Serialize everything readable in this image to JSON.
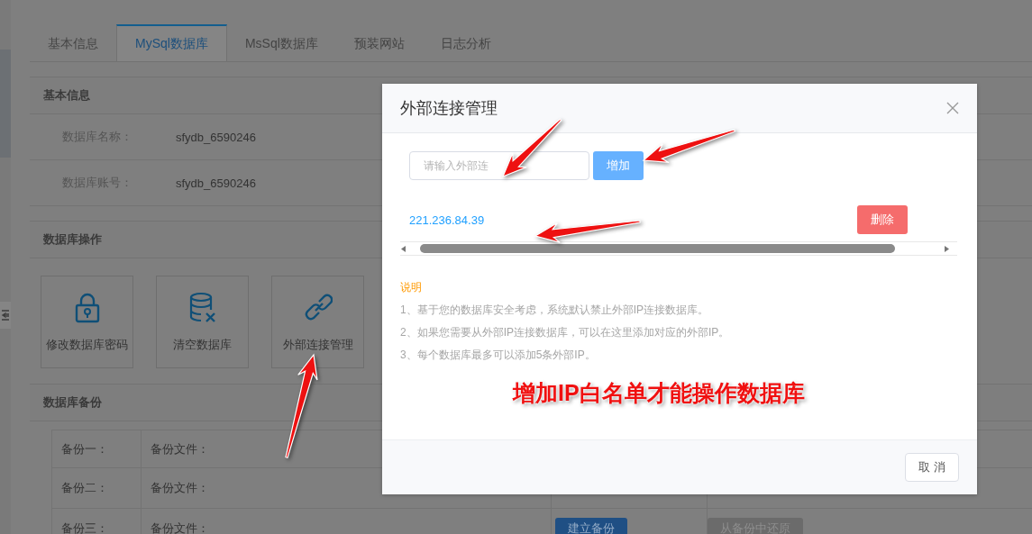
{
  "tabs": [
    {
      "label": "基本信息",
      "selected": false
    },
    {
      "label": "MySql数据库",
      "selected": true
    },
    {
      "label": "MsSql数据库",
      "selected": false
    },
    {
      "label": "预装网站",
      "selected": false
    },
    {
      "label": "日志分析",
      "selected": false
    }
  ],
  "basic_info": {
    "title": "基本信息",
    "fields": [
      {
        "label": "数据库名称：",
        "value": "sfydb_6590246"
      },
      {
        "label": "数据库账号：",
        "value": "sfydb_6590246"
      }
    ]
  },
  "operations": {
    "title": "数据库操作",
    "actions": [
      {
        "kind": "lock",
        "label": "修改数据库密码"
      },
      {
        "kind": "database-clear",
        "label": "清空数据库"
      },
      {
        "kind": "link",
        "label": "外部连接管理"
      }
    ]
  },
  "backup": {
    "title": "数据库备份",
    "rows": [
      {
        "name": "备份一：",
        "file_label": "备份文件："
      },
      {
        "name": "备份二：",
        "file_label": "备份文件："
      },
      {
        "name": "备份三：",
        "file_label": "备份文件：",
        "buttons": [
          {
            "label": "建立备份",
            "disabled": false
          },
          {
            "label": "从备份中还原",
            "disabled": true
          }
        ]
      }
    ]
  },
  "dialog": {
    "title": "外部连接管理",
    "ip_field": {
      "placeholder": "请输入外部连"
    },
    "add_button": "增加",
    "ips": [
      {
        "address": "221.236.84.39",
        "delete_label": "删除"
      }
    ],
    "notes_title": "说明",
    "notes": [
      "1、基于您的数据库安全考虑，系统默认禁止外部IP连接数据库。",
      "2、如果您需要从外部IP连接数据库，可以在这里添加对应的外部IP。",
      "3、每个数据库最多可以添加5条外部IP。"
    ],
    "cancel_button": "取消"
  },
  "annotation": {
    "text": "增加IP白名单才能操作数据库"
  }
}
